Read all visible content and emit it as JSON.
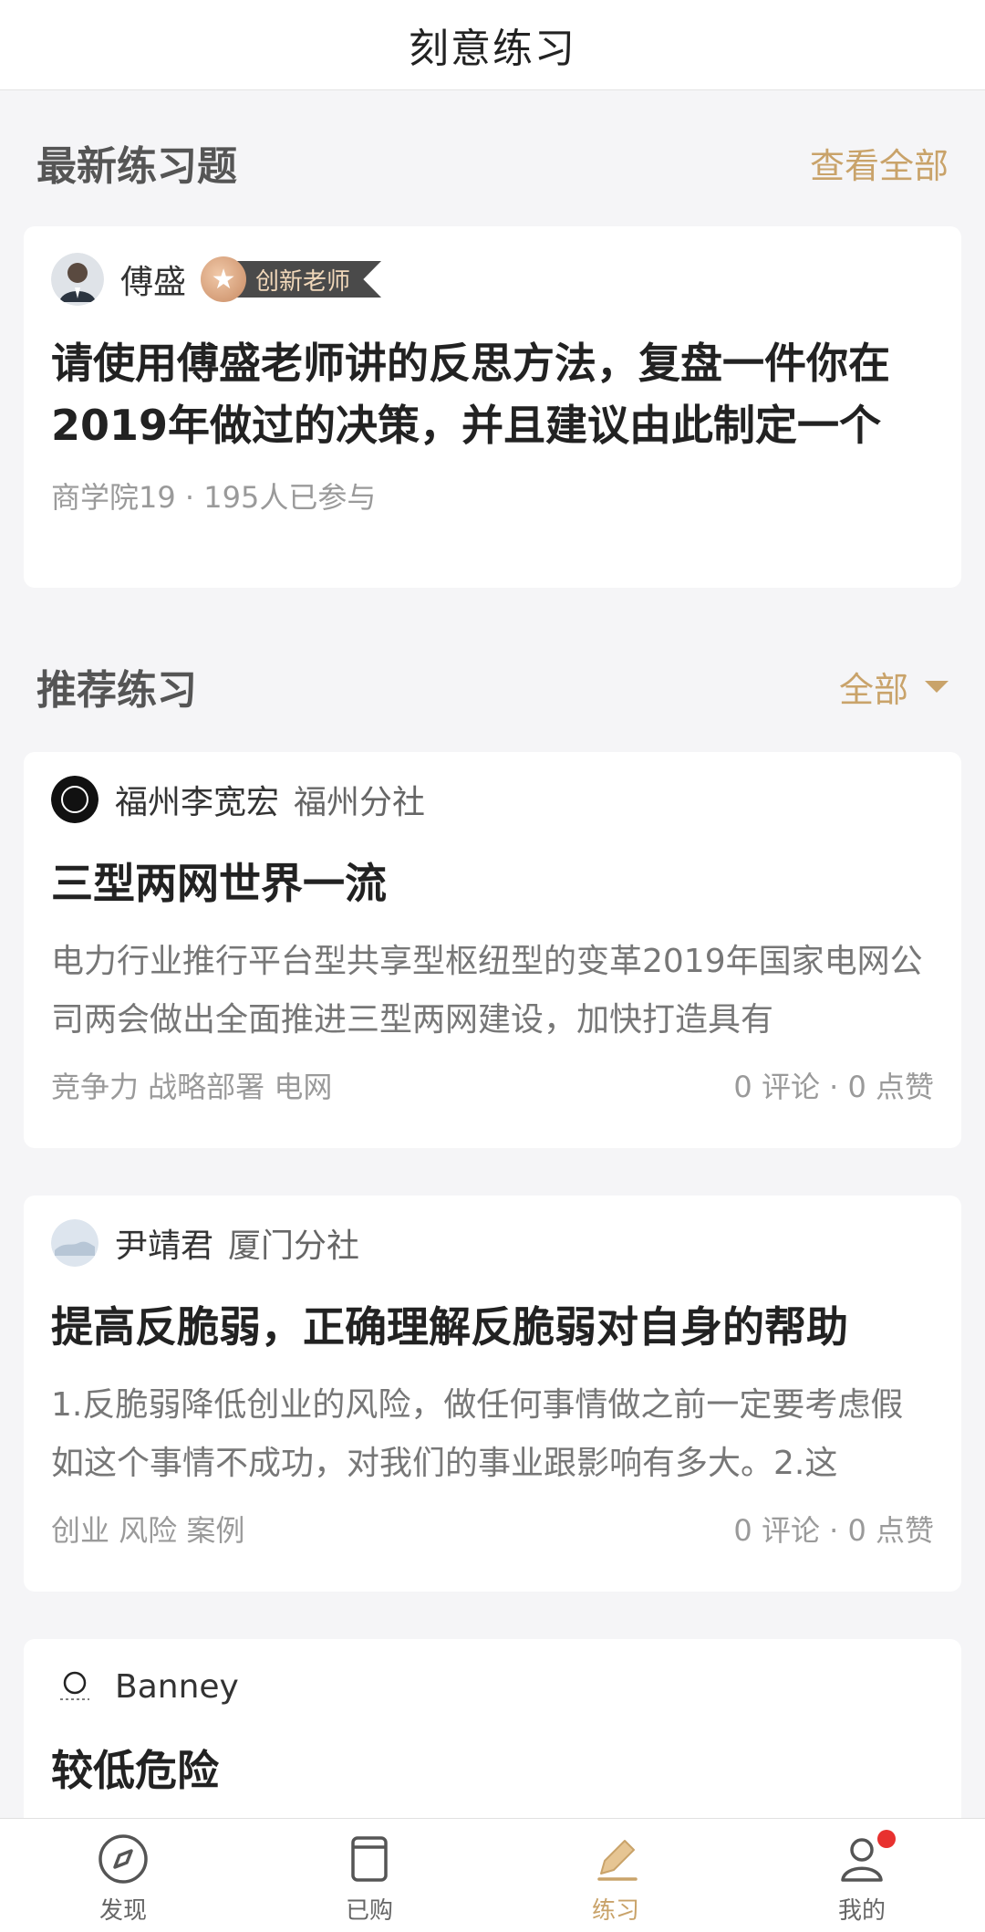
{
  "header": {
    "title": "刻意练习"
  },
  "latest": {
    "heading": "最新练习题",
    "view_all": "查看全部",
    "card": {
      "author": "傅盛",
      "badge": "创新老师",
      "title": "请使用傅盛老师讲的反思方法，复盘一件你在2019年做过的决策，并且建议由此制定一个",
      "meta": "商学院19 · 195人已参与"
    }
  },
  "recommended": {
    "heading": "推荐练习",
    "filter": "全部",
    "items": [
      {
        "author": "福州李宽宏",
        "branch": "福州分社",
        "title": "三型两网世界一流",
        "body": "电力行业推行平台型共享型枢纽型的变革2019年国家电网公司两会做出全面推进三型两网建设，加快打造具有",
        "tags": "竞争力 战略部署 电网",
        "stats": "0 评论 · 0 点赞"
      },
      {
        "author": "尹靖君",
        "branch": "厦门分社",
        "title": "提高反脆弱，正确理解反脆弱对自身的帮助",
        "body": "1.反脆弱降低创业的风险，做任何事情做之前一定要考虑假如这个事情不成功，对我们的事业跟影响有多大。2.这",
        "tags": "创业 风险 案例",
        "stats": "0 评论 · 0 点赞"
      },
      {
        "author": "Banney",
        "branch": "",
        "title": "较低危险"
      }
    ]
  },
  "tabbar": {
    "tabs": [
      {
        "label": "发现",
        "icon": "compass-icon"
      },
      {
        "label": "已购",
        "icon": "book-icon"
      },
      {
        "label": "练习",
        "icon": "pencil-icon"
      },
      {
        "label": "我的",
        "icon": "user-icon"
      }
    ],
    "accent": "#c9a36a",
    "notification_color": "#e8312f"
  }
}
